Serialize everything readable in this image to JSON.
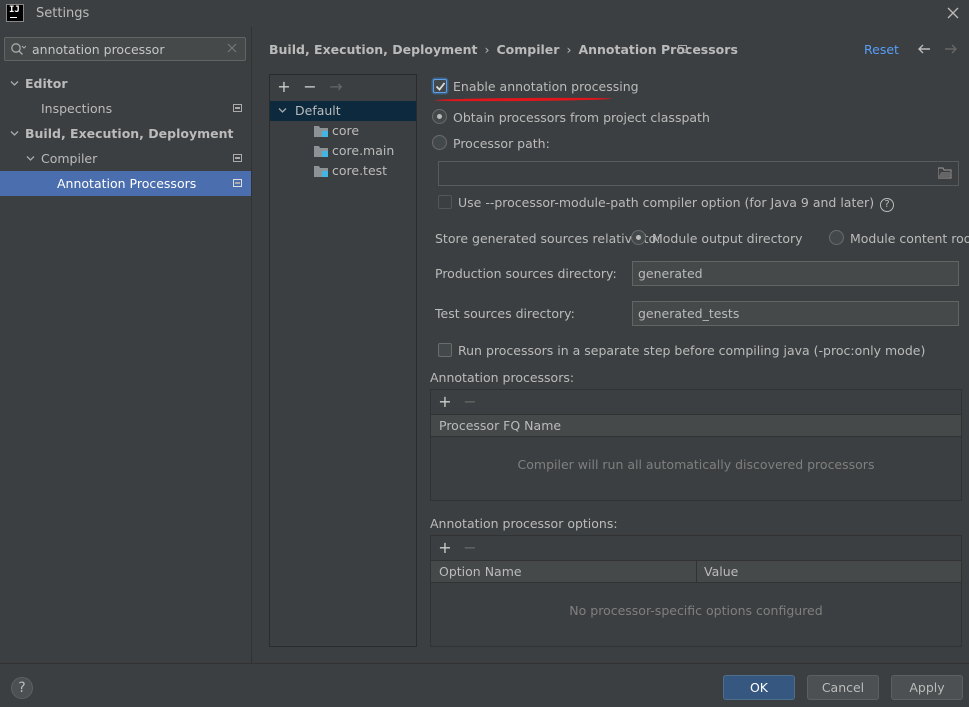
{
  "window": {
    "title": "Settings",
    "logo_text": "IJ"
  },
  "search": {
    "value": "annotation processor"
  },
  "sidebar": {
    "items": [
      {
        "label": "Editor"
      },
      {
        "label": "Inspections"
      },
      {
        "label": "Build, Execution, Deployment"
      },
      {
        "label": "Compiler"
      },
      {
        "label": "Annotation Processors"
      }
    ]
  },
  "header": {
    "breadcrumb": [
      "Build, Execution, Deployment",
      "Compiler",
      "Annotation Processors"
    ],
    "separator": "›",
    "reset_label": "Reset"
  },
  "profiles": {
    "toolbar": {
      "add": "+",
      "remove": "−",
      "move": "→"
    },
    "default_label": "Default",
    "modules": [
      "core",
      "core.main",
      "core.test"
    ]
  },
  "form": {
    "enable_label": "Enable annotation processing",
    "obtain_label": "Obtain processors from project classpath",
    "processor_path_label": "Processor path:",
    "processor_path_value": "",
    "module_path_label": "Use --processor-module-path compiler option (for Java 9 and later)",
    "store_label": "Store generated sources relative to:",
    "store_opt1": "Module output directory",
    "store_opt2": "Module content root",
    "prod_dir_label": "Production sources directory:",
    "prod_dir_value": "generated",
    "test_dir_label": "Test sources directory:",
    "test_dir_value": "generated_tests",
    "separate_step_label": "Run processors in a separate step before compiling java (-proc:only mode)",
    "processors_section": "Annotation processors:",
    "processors_col": "Processor FQ Name",
    "processors_empty": "Compiler will run all automatically discovered processors",
    "options_section": "Annotation processor options:",
    "options_col_name": "Option Name",
    "options_col_value": "Value",
    "options_empty": "No processor-specific options configured",
    "add_glyph": "+",
    "remove_glyph": "−"
  },
  "footer": {
    "help": "?",
    "ok": "OK",
    "cancel": "Cancel",
    "apply": "Apply"
  },
  "colors": {
    "selection": "#4b6eaf",
    "link": "#589df6",
    "primary_button": "#365880",
    "annotation_underline": "#e0161d"
  }
}
